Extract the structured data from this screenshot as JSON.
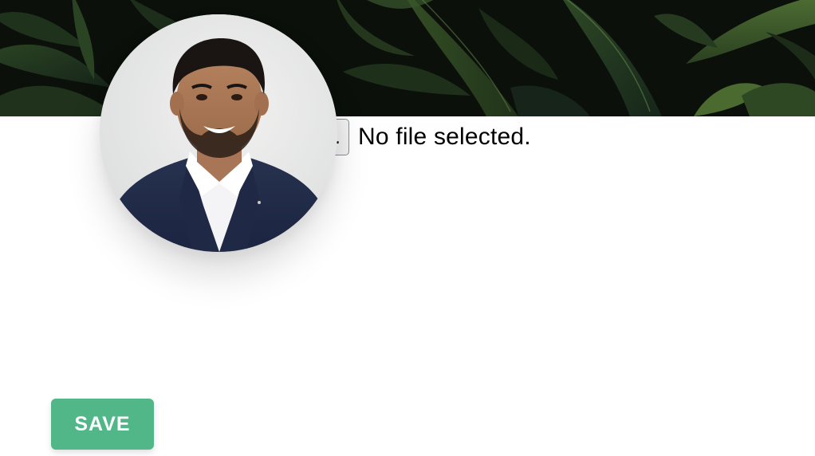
{
  "cover": {
    "image_description_icon": "foliage-cover-image"
  },
  "avatar": {
    "icon": "profile-photo"
  },
  "file_input": {
    "button_label": ".",
    "status_text": "No file selected."
  },
  "actions": {
    "save_label": "SAVE"
  },
  "colors": {
    "save_button_bg": "#52b788",
    "cover_bg": "#0a0f08"
  }
}
